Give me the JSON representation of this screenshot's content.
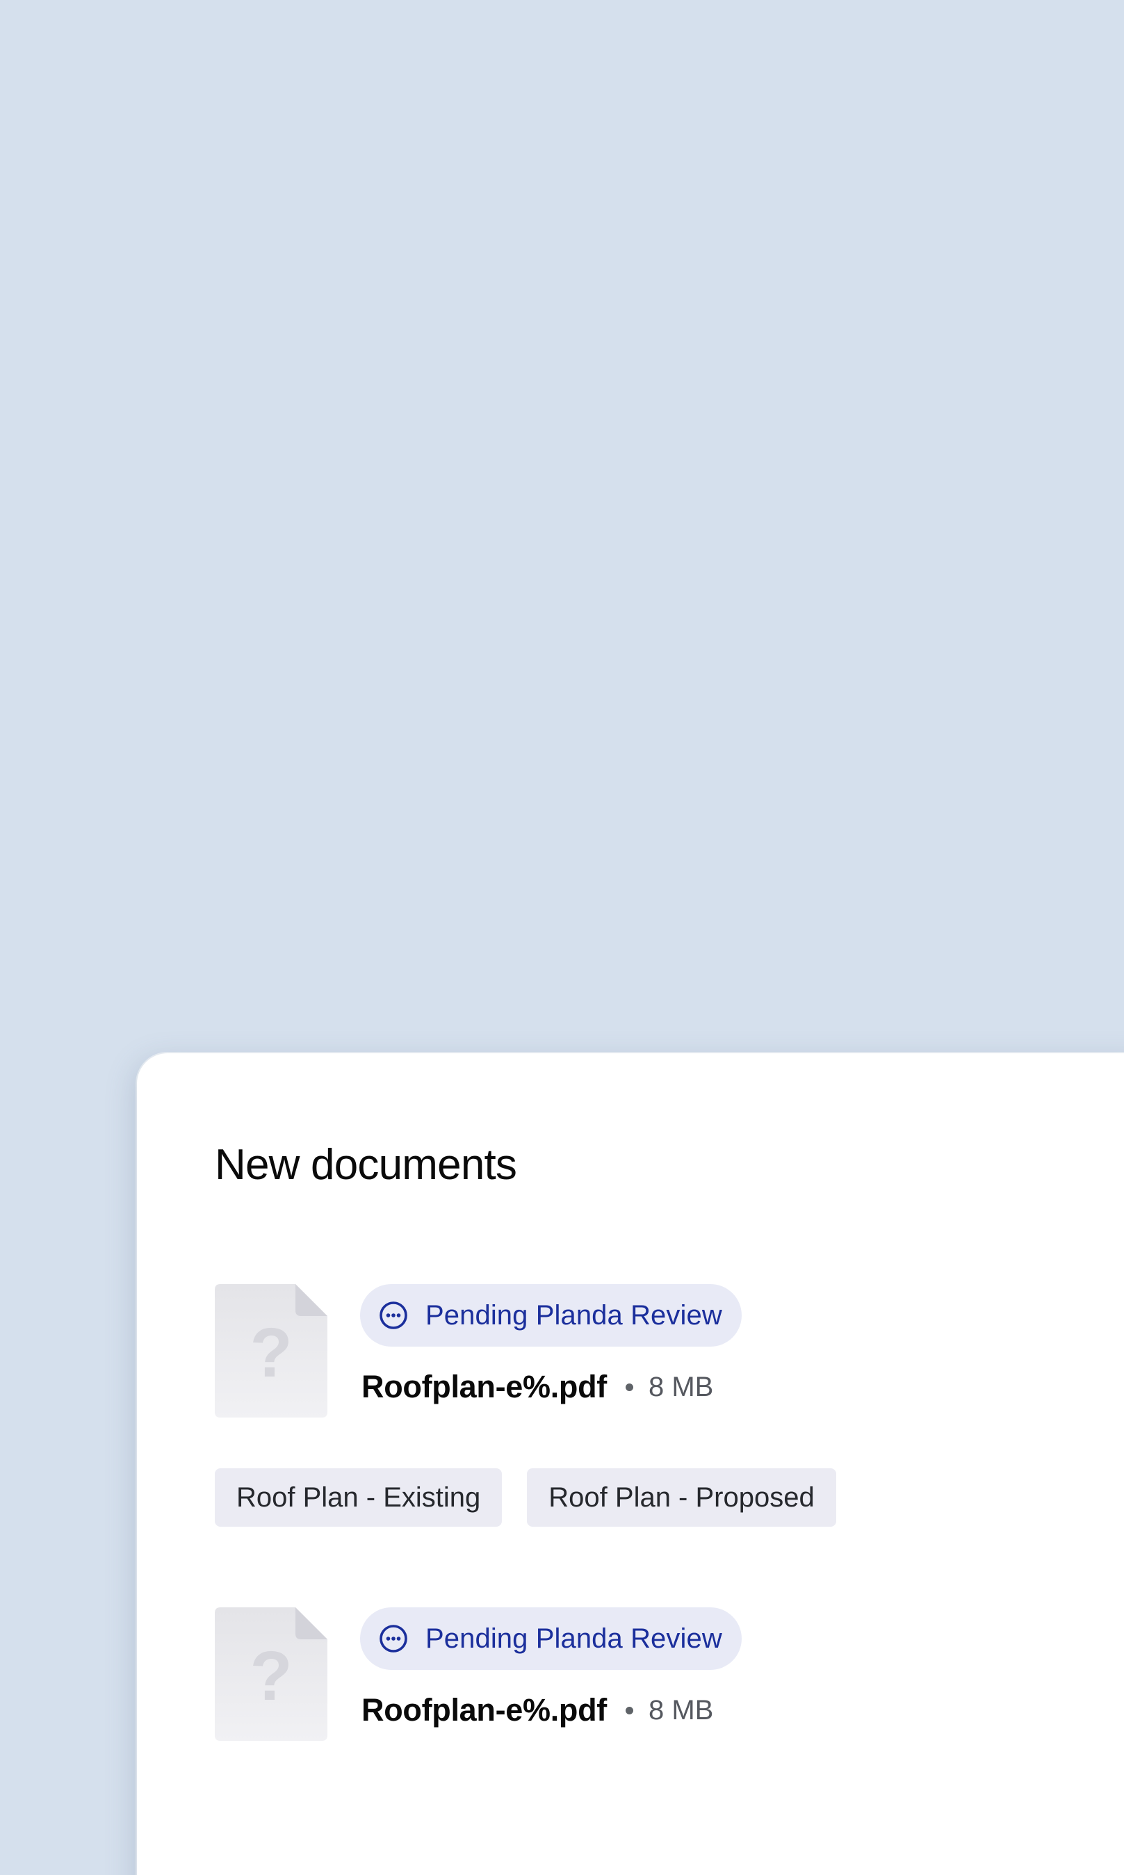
{
  "panel": {
    "title": "New documents"
  },
  "documents": [
    {
      "status": "Pending Planda Review",
      "status_icon": "ellipsis-circle-icon",
      "file_icon": "unknown-file-icon",
      "name": "Roofplan-e%.pdf",
      "size": "8 MB"
    },
    {
      "status": "Pending Planda Review",
      "status_icon": "ellipsis-circle-icon",
      "file_icon": "unknown-file-icon",
      "name": "Roofplan-e%.pdf",
      "size": "8 MB"
    }
  ],
  "tags": [
    "Roof Plan - Existing",
    "Roof Plan - Proposed"
  ],
  "colors": {
    "background": "#d5e0ed",
    "card": "#ffffff",
    "status_pill_bg": "#e8eaf6",
    "status_text": "#1b2f9c",
    "tag_bg": "#ebebf3"
  }
}
